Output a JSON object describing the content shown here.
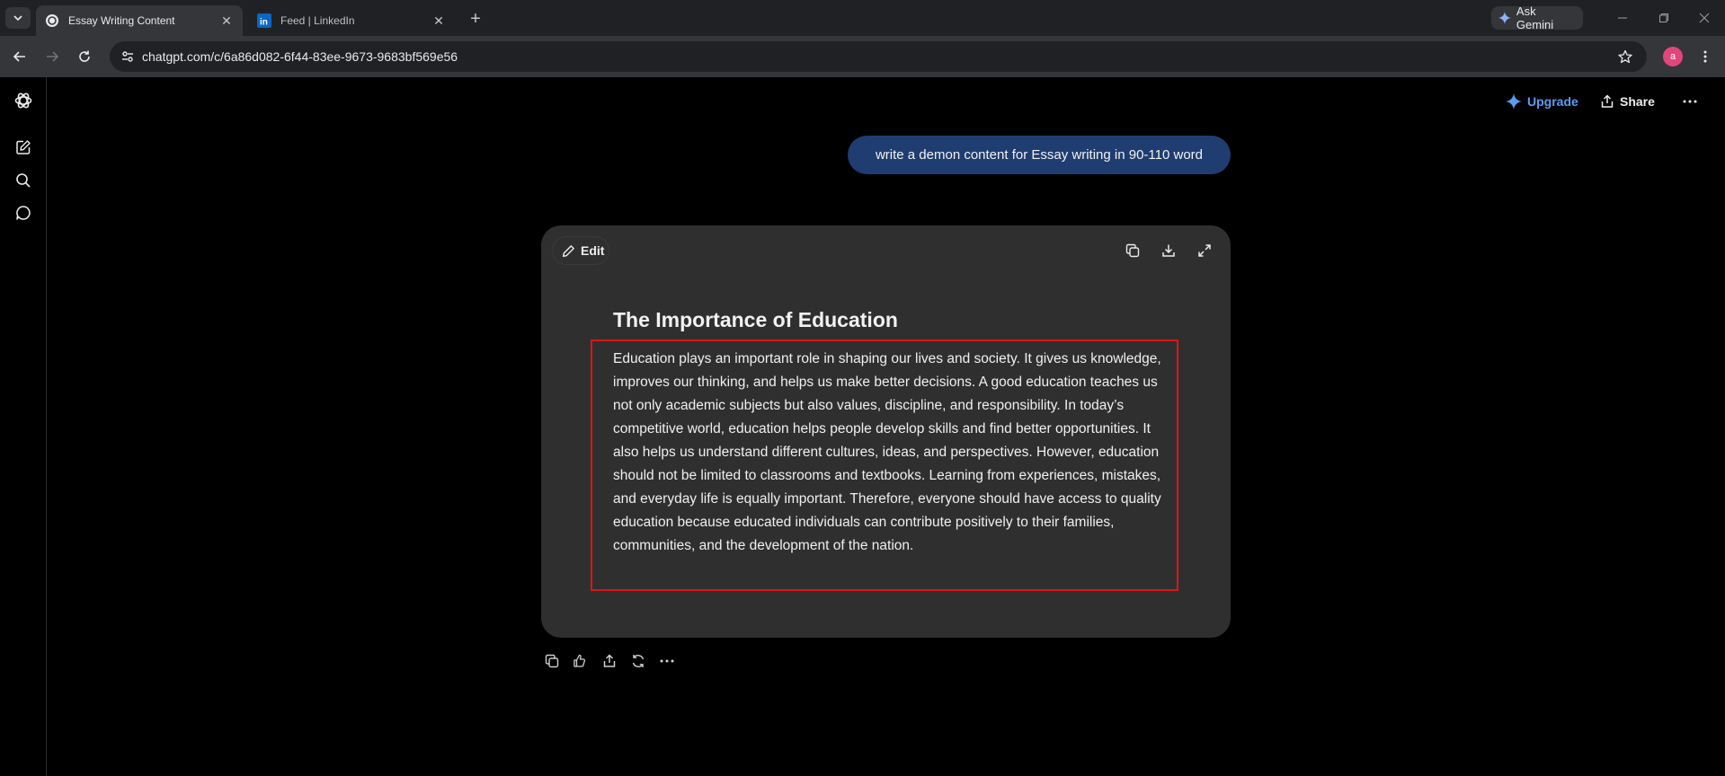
{
  "browser": {
    "tabs": [
      {
        "title": "Essay Writing Content",
        "active": true,
        "favicon": "chatgpt-icon"
      },
      {
        "title": "Feed | LinkedIn",
        "active": false,
        "favicon": "linkedin-icon"
      }
    ],
    "ask_gemini_label": "Ask Gemini",
    "url": "chatgpt.com/c/6a86d082-6f44-83ee-9673-9683bf569e56",
    "profile_initial": "a"
  },
  "header": {
    "upgrade_label": "Upgrade",
    "share_label": "Share"
  },
  "conversation": {
    "user_message": "write a demon content for Essay writing in 90-110 word"
  },
  "canvas": {
    "edit_label": "Edit",
    "title": "The Importance of Education",
    "body": "Education plays an important role in shaping our lives and society. It gives us knowledge, improves our thinking, and helps us make better decisions. A good education teaches us not only academic subjects but also values, discipline, and responsibility. In today’s competitive world, education helps people develop skills and find better opportunities. It also helps us understand different cultures, ideas, and perspectives. However, education should not be limited to classrooms and textbooks. Learning from experiences, mistakes, and everyday life is equally important. Therefore, everyone should have access to quality education because educated individuals can contribute positively to their families, communities, and the development of the nation."
  },
  "colors": {
    "accent_upgrade": "#5b9cf5",
    "user_bubble": "#1f3d70",
    "highlight": "#e01414",
    "card_bg": "#2f2f2f"
  }
}
